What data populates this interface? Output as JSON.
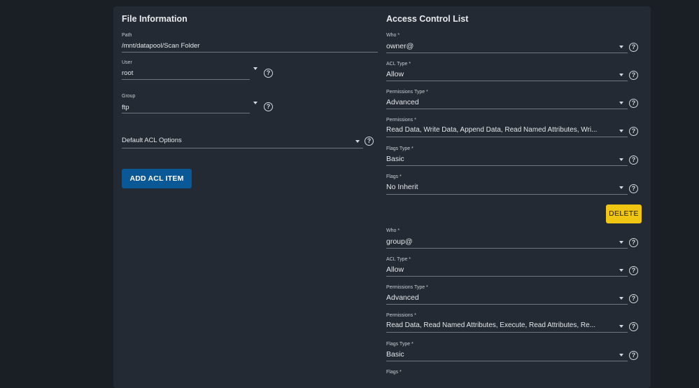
{
  "file_info": {
    "title": "File Information",
    "path": {
      "label": "Path",
      "value": "/mnt/datapool/Scan Folder"
    },
    "user": {
      "label": "User",
      "value": "root"
    },
    "group": {
      "label": "Group",
      "value": "ftp"
    },
    "default_acl": {
      "value": "Default ACL Options"
    },
    "add_button": "ADD ACL ITEM"
  },
  "acl": {
    "title": "Access Control List",
    "help_glyph": "?",
    "delete_label": "DELETE",
    "items": [
      {
        "who_label": "Who *",
        "who": "owner@",
        "acl_type_label": "ACL Type *",
        "acl_type": "Allow",
        "perm_type_label": "Permissions Type *",
        "perm_type": "Advanced",
        "perms_label": "Permissions *",
        "perms": "Read Data, Write Data, Append Data, Read Named Attributes, Wri...",
        "flags_type_label": "Flags Type *",
        "flags_type": "Basic",
        "flags_label": "Flags *",
        "flags": "No Inherit"
      },
      {
        "who_label": "Who *",
        "who": "group@",
        "acl_type_label": "ACL Type *",
        "acl_type": "Allow",
        "perm_type_label": "Permissions Type *",
        "perm_type": "Advanced",
        "perms_label": "Permissions *",
        "perms": "Read Data, Read Named Attributes, Execute, Read Attributes, Re...",
        "flags_type_label": "Flags Type *",
        "flags_type": "Basic",
        "flags_label": "Flags *",
        "flags": ""
      }
    ]
  }
}
